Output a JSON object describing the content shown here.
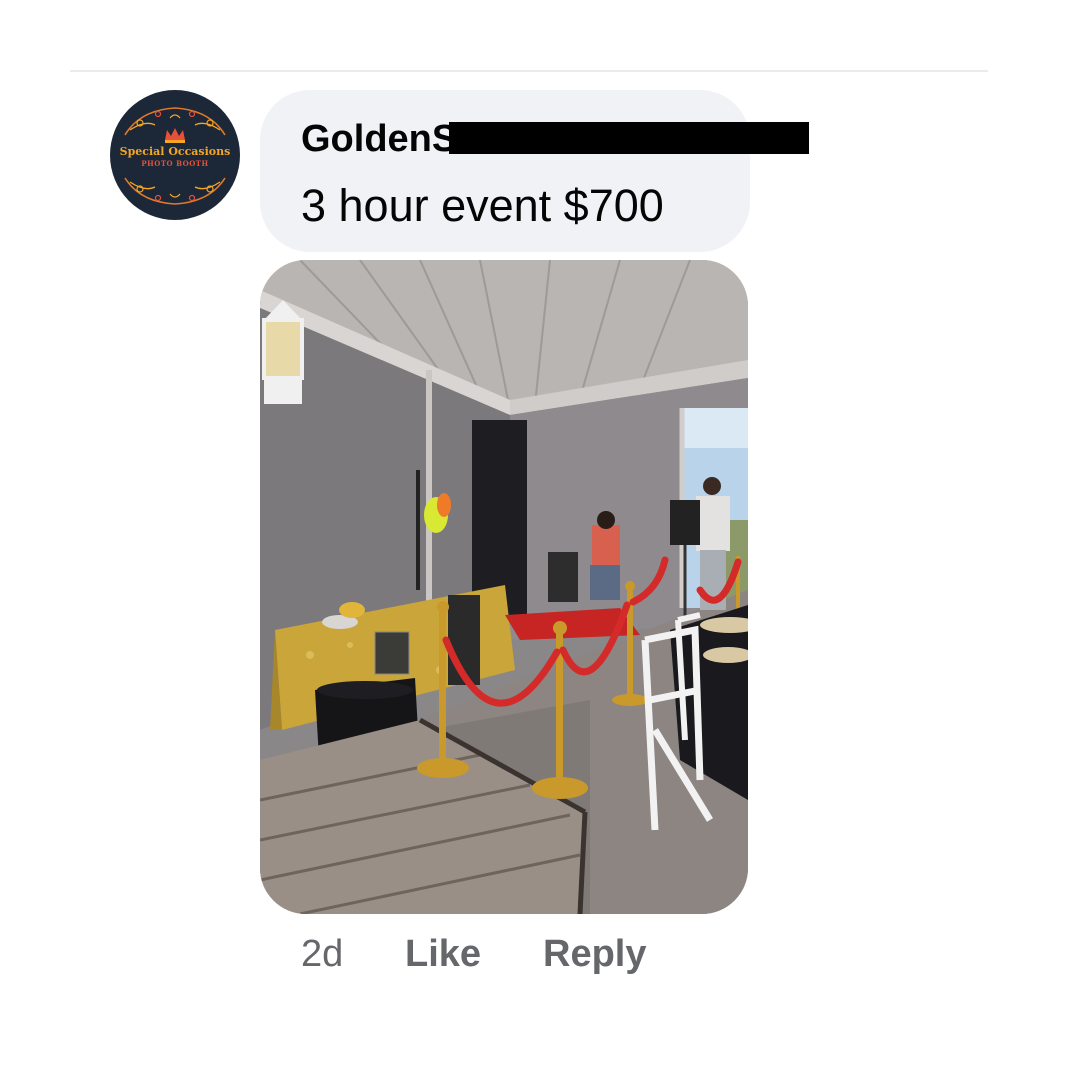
{
  "comment": {
    "commenter_name": "GoldenS",
    "text": "3 hour event $700",
    "time": "2d",
    "like_label": "Like",
    "reply_label": "Reply"
  },
  "avatar": {
    "brand_title": "Special Occasions",
    "brand_subtitle": "PHOTO BOOTH",
    "icon": "crown-icon"
  },
  "colors": {
    "bubble_background": "#f0f2f5",
    "name_text": "#050505",
    "meta_text": "#65676b",
    "avatar_background": "#1c2738",
    "avatar_gold": "#f5a623",
    "avatar_red": "#e9503a"
  }
}
